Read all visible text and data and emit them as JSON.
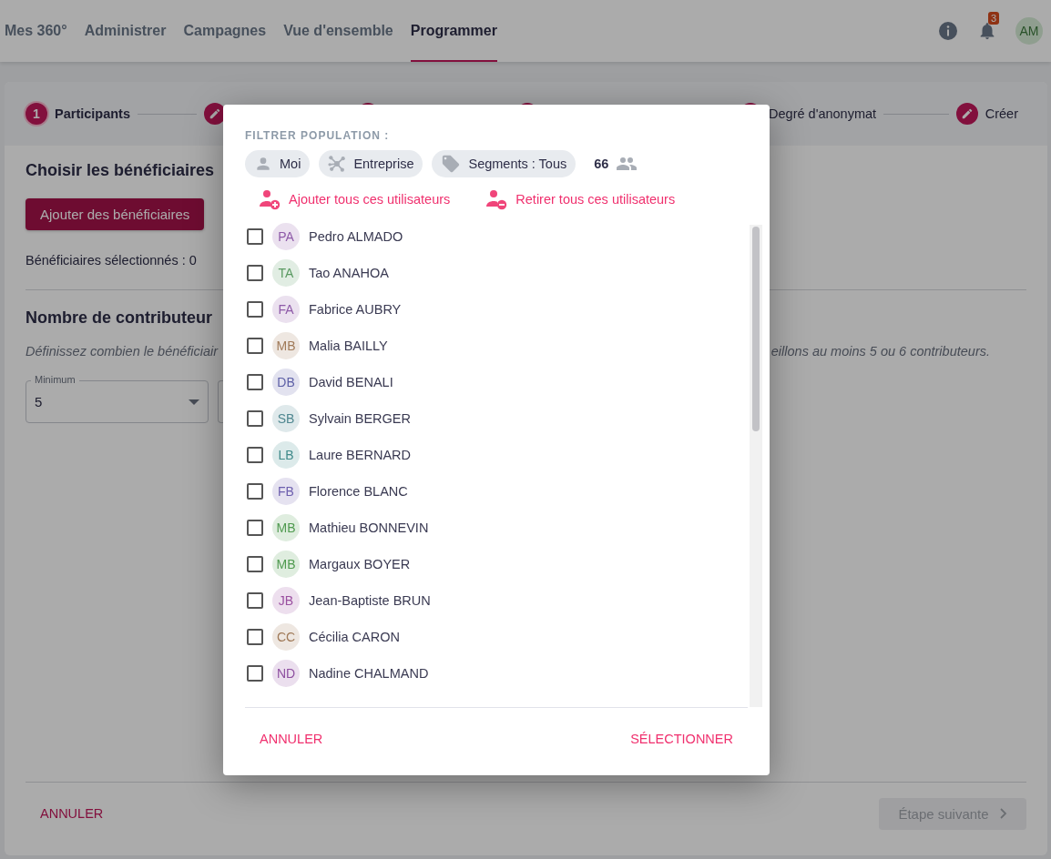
{
  "nav": {
    "items": [
      {
        "label": "Mes 360°",
        "selected": false
      },
      {
        "label": "Administrer",
        "selected": false
      },
      {
        "label": "Campagnes",
        "selected": false
      },
      {
        "label": "Vue d'ensemble",
        "selected": false
      },
      {
        "label": "Programmer",
        "selected": true
      }
    ],
    "notifications": "3",
    "avatar": "AM"
  },
  "stepper": {
    "steps": [
      {
        "kind": "number",
        "number": "1",
        "label": "Participants",
        "selected": true
      },
      {
        "kind": "edit",
        "selected": false
      },
      {
        "kind": "dot",
        "selected": false
      },
      {
        "kind": "dot",
        "selected": false
      },
      {
        "kind": "dot",
        "label": "Degré d'anonymat",
        "selected": false
      },
      {
        "kind": "edit",
        "label": "Créer",
        "selected": false
      }
    ]
  },
  "beneficiaries": {
    "heading": "Choisir les bénéficiaires",
    "add_button": "Ajouter des bénéficiaires",
    "selected_count": "Bénéficiaires sélectionnés : 0"
  },
  "contributors": {
    "heading": "Nombre de contributeur",
    "hint_left": "Définissez combien le bénéficiair",
    "hint_right": "eillons au moins 5 ou 6 contributeurs.",
    "minimum": {
      "label": "Minimum",
      "value": "5"
    }
  },
  "footer": {
    "cancel": "ANNULER",
    "next": {
      "label": "Étape suivante",
      "disabled": true
    }
  },
  "dialog": {
    "filter_title": "FILTRER POPULATION :",
    "chips": [
      {
        "kind": "person",
        "label": "Moi"
      },
      {
        "kind": "network",
        "label": "Entreprise"
      },
      {
        "kind": "tag",
        "label": "Segments : Tous"
      }
    ],
    "count": "66",
    "actions": [
      {
        "kind": "add",
        "label": "Ajouter tous ces utilisateurs"
      },
      {
        "kind": "remove",
        "label": "Retirer tous ces utilisateurs"
      }
    ],
    "users": [
      {
        "initials": "PA",
        "name": "Pedro ALMADO",
        "checked": false,
        "color": "#8e5aa8"
      },
      {
        "initials": "TA",
        "name": "Tao ANAHOA",
        "checked": false,
        "color": "#5a9a62"
      },
      {
        "initials": "FA",
        "name": "Fabrice AUBRY",
        "checked": false,
        "color": "#8e5aa8"
      },
      {
        "initials": "MB",
        "name": "Malia BAILLY",
        "checked": false,
        "color": "#a07a58"
      },
      {
        "initials": "DB",
        "name": "David BENALI",
        "checked": false,
        "color": "#5c5fa6"
      },
      {
        "initials": "SB",
        "name": "Sylvain BERGER",
        "checked": false,
        "color": "#4f8790"
      },
      {
        "initials": "LB",
        "name": "Laure BERNARD",
        "checked": false,
        "color": "#3f8a8a"
      },
      {
        "initials": "FB",
        "name": "Florence BLANC",
        "checked": false,
        "color": "#6d5fae"
      },
      {
        "initials": "MB",
        "name": "Mathieu BONNEVIN",
        "checked": false,
        "color": "#4f9a4f"
      },
      {
        "initials": "MB",
        "name": "Margaux BOYER",
        "checked": false,
        "color": "#4f9a4f"
      },
      {
        "initials": "JB",
        "name": "Jean-Baptiste BRUN",
        "checked": false,
        "color": "#9a4fa0"
      },
      {
        "initials": "CC",
        "name": "Cécilia CARON",
        "checked": false,
        "color": "#a07a58"
      },
      {
        "initials": "ND",
        "name": "Nadine CHALMAND",
        "checked": false,
        "color": "#8e4fa0"
      }
    ],
    "cancel": "ANNULER",
    "select": "SÉLECTIONNER"
  }
}
